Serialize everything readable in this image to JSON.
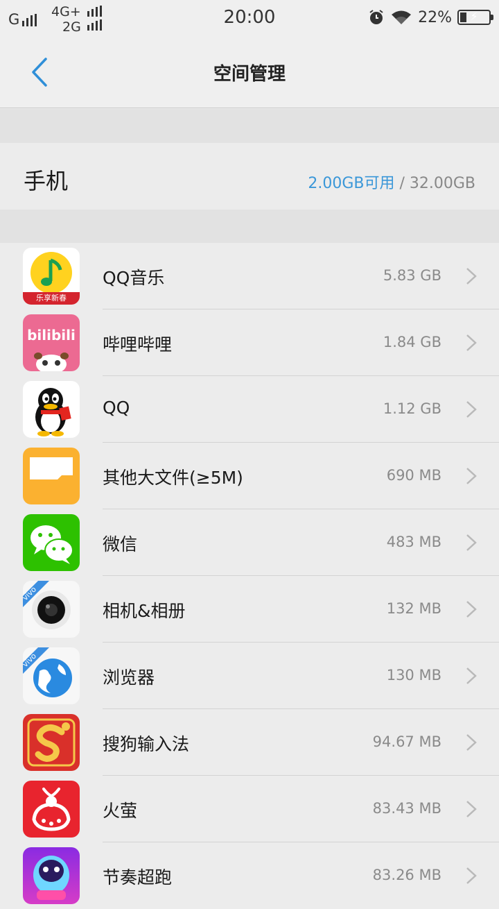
{
  "status_bar": {
    "carrier1": "G",
    "network_top": "4G+",
    "network_bottom": "2G",
    "time": "20:00",
    "battery_percent": "22%",
    "battery_level": 0.22
  },
  "header": {
    "title": "空间管理"
  },
  "phone": {
    "label": "手机",
    "available": "2.00GB可用",
    "separator": " / ",
    "total": "32.00GB"
  },
  "apps": [
    {
      "name": "QQ音乐",
      "size": "5.83 GB",
      "icon": "qq-music-icon"
    },
    {
      "name": "哔哩哔哩",
      "size": "1.84 GB",
      "icon": "bilibili-icon"
    },
    {
      "name": "QQ",
      "size": "1.12 GB",
      "icon": "qq-icon"
    },
    {
      "name": "其他大文件(≥5M)",
      "size": "690 MB",
      "icon": "folder-icon"
    },
    {
      "name": "微信",
      "size": "483 MB",
      "icon": "wechat-icon"
    },
    {
      "name": "相机&相册",
      "size": "132 MB",
      "icon": "camera-icon"
    },
    {
      "name": "浏览器",
      "size": "130 MB",
      "icon": "browser-icon"
    },
    {
      "name": "搜狗输入法",
      "size": "94.67 MB",
      "icon": "sogou-input-icon"
    },
    {
      "name": "火萤",
      "size": "83.43 MB",
      "icon": "firefly-icon"
    },
    {
      "name": "节奏超跑",
      "size": "83.26 MB",
      "icon": "rhythm-racer-icon"
    }
  ],
  "icon_labels": {
    "qq_music_badge": "乐享新春",
    "bilibili_logo": "bilibili",
    "vivo": "vivo"
  },
  "colors": {
    "accent": "#3a97d8"
  }
}
